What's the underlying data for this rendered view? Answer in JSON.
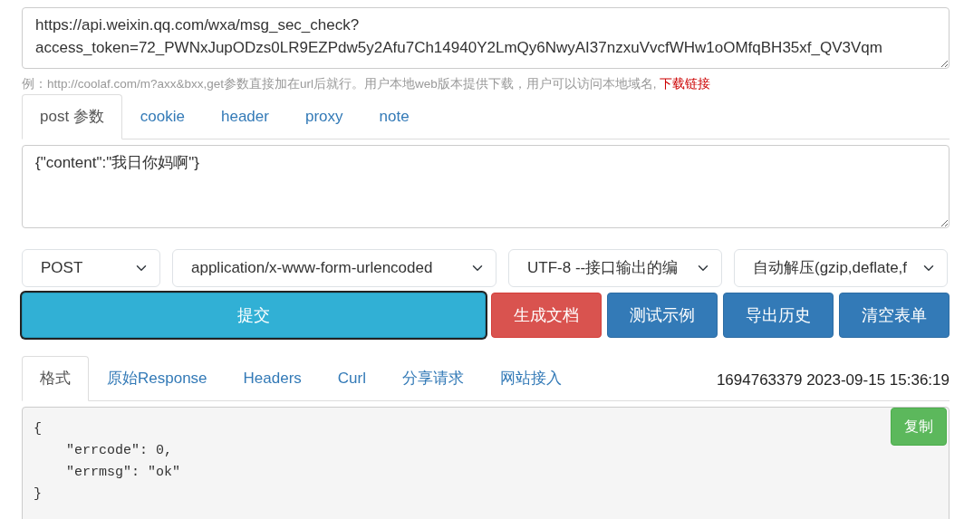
{
  "url_field": {
    "value": "https://api.weixin.qq.com/wxa/msg_sec_check?\naccess_token=72_PWNxJupODzs0LR9EZPdw5y2Afu7Ch14940Y2LmQy6NwyAI37nzxuVvcfWHw1oOMfqBH35xf_QV3Vqm"
  },
  "hint": {
    "text": "例：http://coolaf.com/m?axx&bxx,get参数直接加在url后就行。用户本地web版本提供下载，用户可以访问本地域名, ",
    "link": "下载链接"
  },
  "request_tabs": [
    {
      "label": "post 参数",
      "selected": true
    },
    {
      "label": "cookie",
      "selected": false
    },
    {
      "label": "header",
      "selected": false
    },
    {
      "label": "proxy",
      "selected": false
    },
    {
      "label": "note",
      "selected": false
    }
  ],
  "body_field": {
    "value": "{\"content\":\"我日你妈啊\"}"
  },
  "selects": [
    {
      "value": "POST"
    },
    {
      "value": "application/x-www-form-urlencoded"
    },
    {
      "value": "UTF-8 --接口输出的编"
    },
    {
      "value": "自动解压(gzip,deflate,f"
    }
  ],
  "buttons": [
    {
      "label": "提交",
      "kind": "info",
      "focused": true
    },
    {
      "label": "生成文档",
      "kind": "danger",
      "focused": false
    },
    {
      "label": "测试示例",
      "kind": "primary",
      "focused": false
    },
    {
      "label": "导出历史",
      "kind": "primary",
      "focused": false
    },
    {
      "label": "清空表单",
      "kind": "primary",
      "focused": false
    }
  ],
  "response_tabs": [
    {
      "label": "格式",
      "selected": true
    },
    {
      "label": "原始Response",
      "selected": false
    },
    {
      "label": "Headers",
      "selected": false
    },
    {
      "label": "Curl",
      "selected": false
    },
    {
      "label": "分享请求",
      "selected": false
    },
    {
      "label": "网站接入",
      "selected": false
    }
  ],
  "timestamp": "1694763379 2023-09-15 15:36:19",
  "response": {
    "lines": [
      "{",
      "    \"errcode\": 0,",
      "    \"errmsg\": \"ok\"",
      "}"
    ],
    "copy_button": "复制"
  }
}
